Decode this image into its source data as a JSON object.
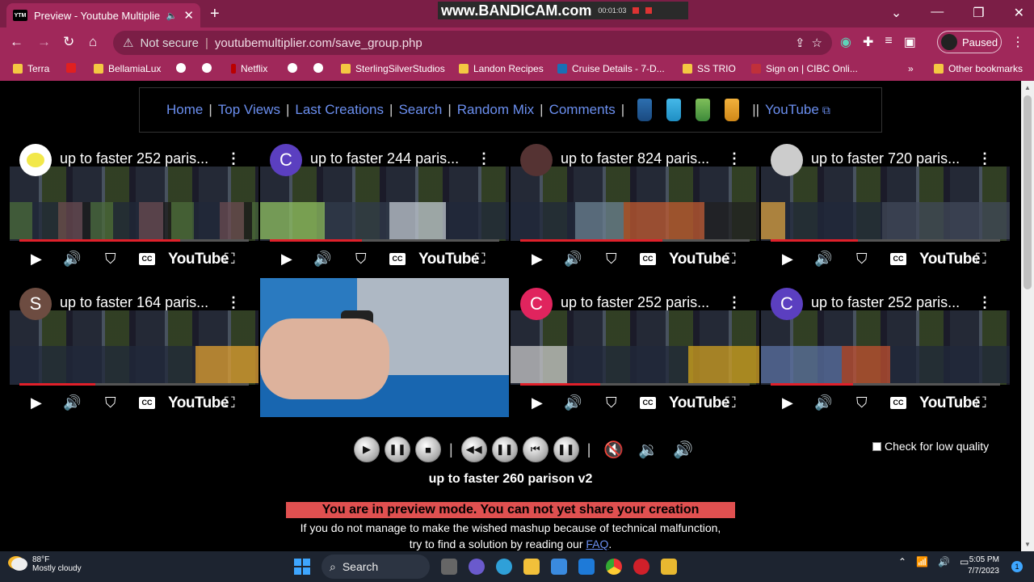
{
  "browser": {
    "tab_title": "Preview - Youtube Multiplier",
    "tab_favicon": "YTM",
    "new_tab": "+",
    "recorder_watermark": "www.BANDICAM.com",
    "recorder_timer": "00:01:03",
    "not_secure": "Not secure",
    "url": "youtubemultiplier.com/save_group.php",
    "profile_status": "Paused"
  },
  "bookmarks": [
    {
      "label": "Terra",
      "icon": "folder"
    },
    {
      "label": "",
      "icon": "youtube"
    },
    {
      "label": "BellamiaLux",
      "icon": "folder"
    },
    {
      "label": "",
      "icon": "globe"
    },
    {
      "label": "",
      "icon": "globe"
    },
    {
      "label": "Netflix",
      "icon": "netflix"
    },
    {
      "label": "",
      "icon": "globe"
    },
    {
      "label": "",
      "icon": "globe"
    },
    {
      "label": "SterlingSilverStudios",
      "icon": "folder"
    },
    {
      "label": "Landon Recipes",
      "icon": "folder"
    },
    {
      "label": "Cruise Details - 7-D...",
      "icon": "cruise"
    },
    {
      "label": "SS TRIO",
      "icon": "folder"
    },
    {
      "label": "Sign on | CIBC Onli...",
      "icon": "cibc"
    },
    {
      "label": "Other bookmarks",
      "icon": "folder"
    }
  ],
  "nav": {
    "links": [
      "Home",
      "Top Views",
      "Last Creations",
      "Search",
      "Random Mix",
      "Comments"
    ],
    "separator": "|",
    "double_separator": "||",
    "youtube_link": "YouTube"
  },
  "videos": [
    {
      "title": "up to faster 252 paris...",
      "avatar": "",
      "avatar_color": "#ffffff"
    },
    {
      "title": "up to faster 244 paris...",
      "avatar": "C",
      "avatar_color": "#5b3fc0"
    },
    {
      "title": "up to faster 824 paris...",
      "avatar": "",
      "avatar_color": "#553333"
    },
    {
      "title": "up to faster 720 paris...",
      "avatar": "",
      "avatar_color": "#cccccc"
    },
    {
      "title": "up to faster 164 paris...",
      "avatar": "S",
      "avatar_color": "#6d4c41"
    },
    {
      "title": "",
      "avatar": "",
      "avatar_color": ""
    },
    {
      "title": "up to faster 252 paris...",
      "avatar": "C",
      "avatar_color": "#e0245e"
    },
    {
      "title": "up to faster 252 paris...",
      "avatar": "C",
      "avatar_color": "#5b3fc0"
    }
  ],
  "player_youtube_word": "YouTube",
  "player_cc": "CC",
  "low_quality_label": "Check for low quality",
  "mix_title": "up to faster 260 parison v2",
  "preview_notice": "You are in preview mode. You can not yet share your creation",
  "help_line1": "If you do not manage to make the wished mashup because of technical malfunction,",
  "help_line2_pre": "try to find a solution by reading our",
  "help_link": "FAQ",
  "help_line2_post": ".",
  "taskbar": {
    "temperature": "88°F",
    "weather": "Mostly cloudy",
    "search": "Search",
    "time": "5:05 PM",
    "date": "7/7/2023",
    "notifications": "1"
  },
  "colors": {
    "chrome_dark": "#7b1e46",
    "chrome": "#a0285a",
    "link": "#6b8ff0",
    "preview_bg": "#e05050"
  }
}
